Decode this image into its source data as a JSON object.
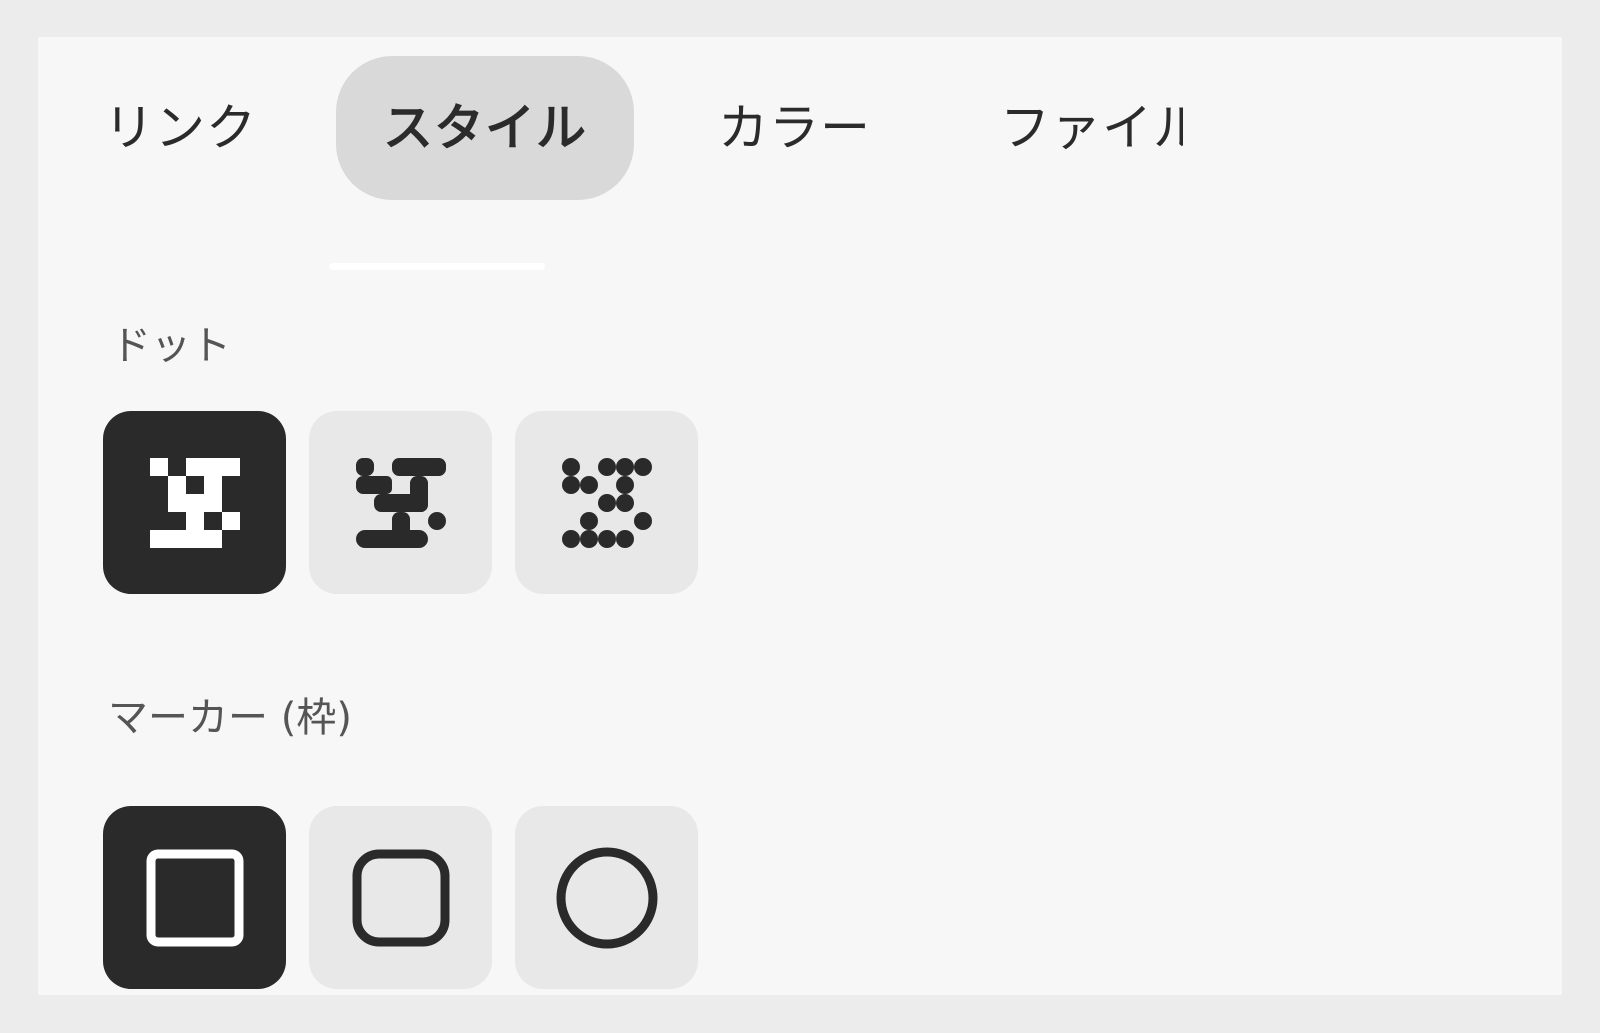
{
  "tabs": [
    {
      "label": "リンク",
      "active": false
    },
    {
      "label": "スタイル",
      "active": true
    },
    {
      "label": "カラー",
      "active": false
    },
    {
      "label": "ファイル",
      "active": false
    }
  ],
  "sections": {
    "dots": {
      "label": "ドット",
      "options": [
        {
          "icon": "square-dots-icon",
          "selected": true
        },
        {
          "icon": "rounded-dots-icon",
          "selected": false
        },
        {
          "icon": "circle-dots-icon",
          "selected": false
        }
      ]
    },
    "marker": {
      "label": "マーカー (枠)",
      "options": [
        {
          "icon": "square-marker-icon",
          "selected": true
        },
        {
          "icon": "rounded-square-marker-icon",
          "selected": false
        },
        {
          "icon": "circle-marker-icon",
          "selected": false
        }
      ]
    }
  },
  "colors": {
    "selected_bg": "#2a2a2a",
    "option_bg": "#e8e8e8",
    "active_tab_bg": "#d9d9d9",
    "panel_bg": "#f7f7f7"
  }
}
